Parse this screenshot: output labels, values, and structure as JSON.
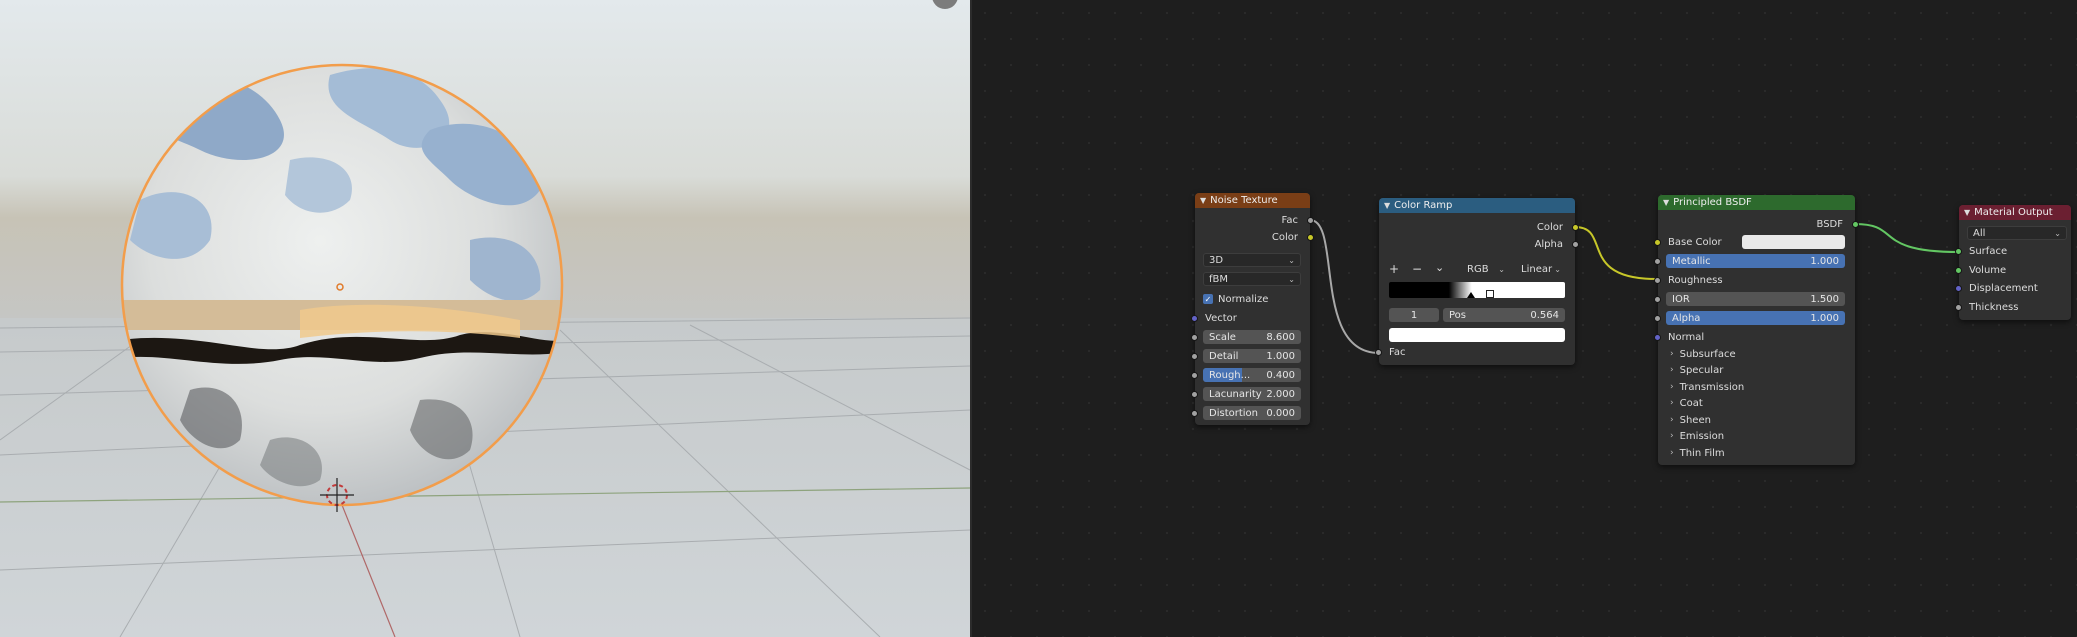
{
  "nodes": {
    "noise": {
      "title": "Noise Texture",
      "out_fac": "Fac",
      "out_color": "Color",
      "dimensions": "3D",
      "type": "fBM",
      "normalize_label": "Normalize",
      "normalize_checked": true,
      "vector_label": "Vector",
      "fields": [
        {
          "label": "Scale",
          "value": "8.600"
        },
        {
          "label": "Detail",
          "value": "1.000"
        },
        {
          "label": "Rough...",
          "value": "0.400"
        },
        {
          "label": "Lacunarity",
          "value": "2.000"
        },
        {
          "label": "Distortion",
          "value": "0.000"
        }
      ],
      "roughness_fill": 0.4
    },
    "ramp": {
      "title": "Color Ramp",
      "out_color": "Color",
      "out_alpha": "Alpha",
      "add": "+",
      "remove": "−",
      "menu": "⌄",
      "color_mode": "RGB",
      "interpolation": "Linear",
      "index": "1",
      "pos_label": "Pos",
      "pos_value": "0.564",
      "in_fac": "Fac"
    },
    "bsdf": {
      "title": "Principled BSDF",
      "out_bsdf": "BSDF",
      "base_color": "Base Color",
      "metallic_label": "Metallic",
      "metallic_value": "1.000",
      "roughness": "Roughness",
      "ior_label": "IOR",
      "ior_value": "1.500",
      "alpha_label": "Alpha",
      "alpha_value": "1.000",
      "normal": "Normal",
      "panels": [
        "Subsurface",
        "Specular",
        "Transmission",
        "Coat",
        "Sheen",
        "Emission",
        "Thin Film"
      ]
    },
    "output": {
      "title": "Material Output",
      "target": "All",
      "inputs": [
        "Surface",
        "Volume",
        "Displacement",
        "Thickness"
      ]
    }
  },
  "colors": {
    "noise_header": "#7a3e16",
    "ramp_header": "#2b5d80",
    "bsdf_header": "#2d6a2d",
    "output_header": "#6b1f31",
    "socket_float": "#a1a1a1",
    "socket_color": "#c7c729",
    "socket_vector": "#6363c7",
    "socket_shader": "#63c763",
    "accent_blue": "#4772b3"
  }
}
